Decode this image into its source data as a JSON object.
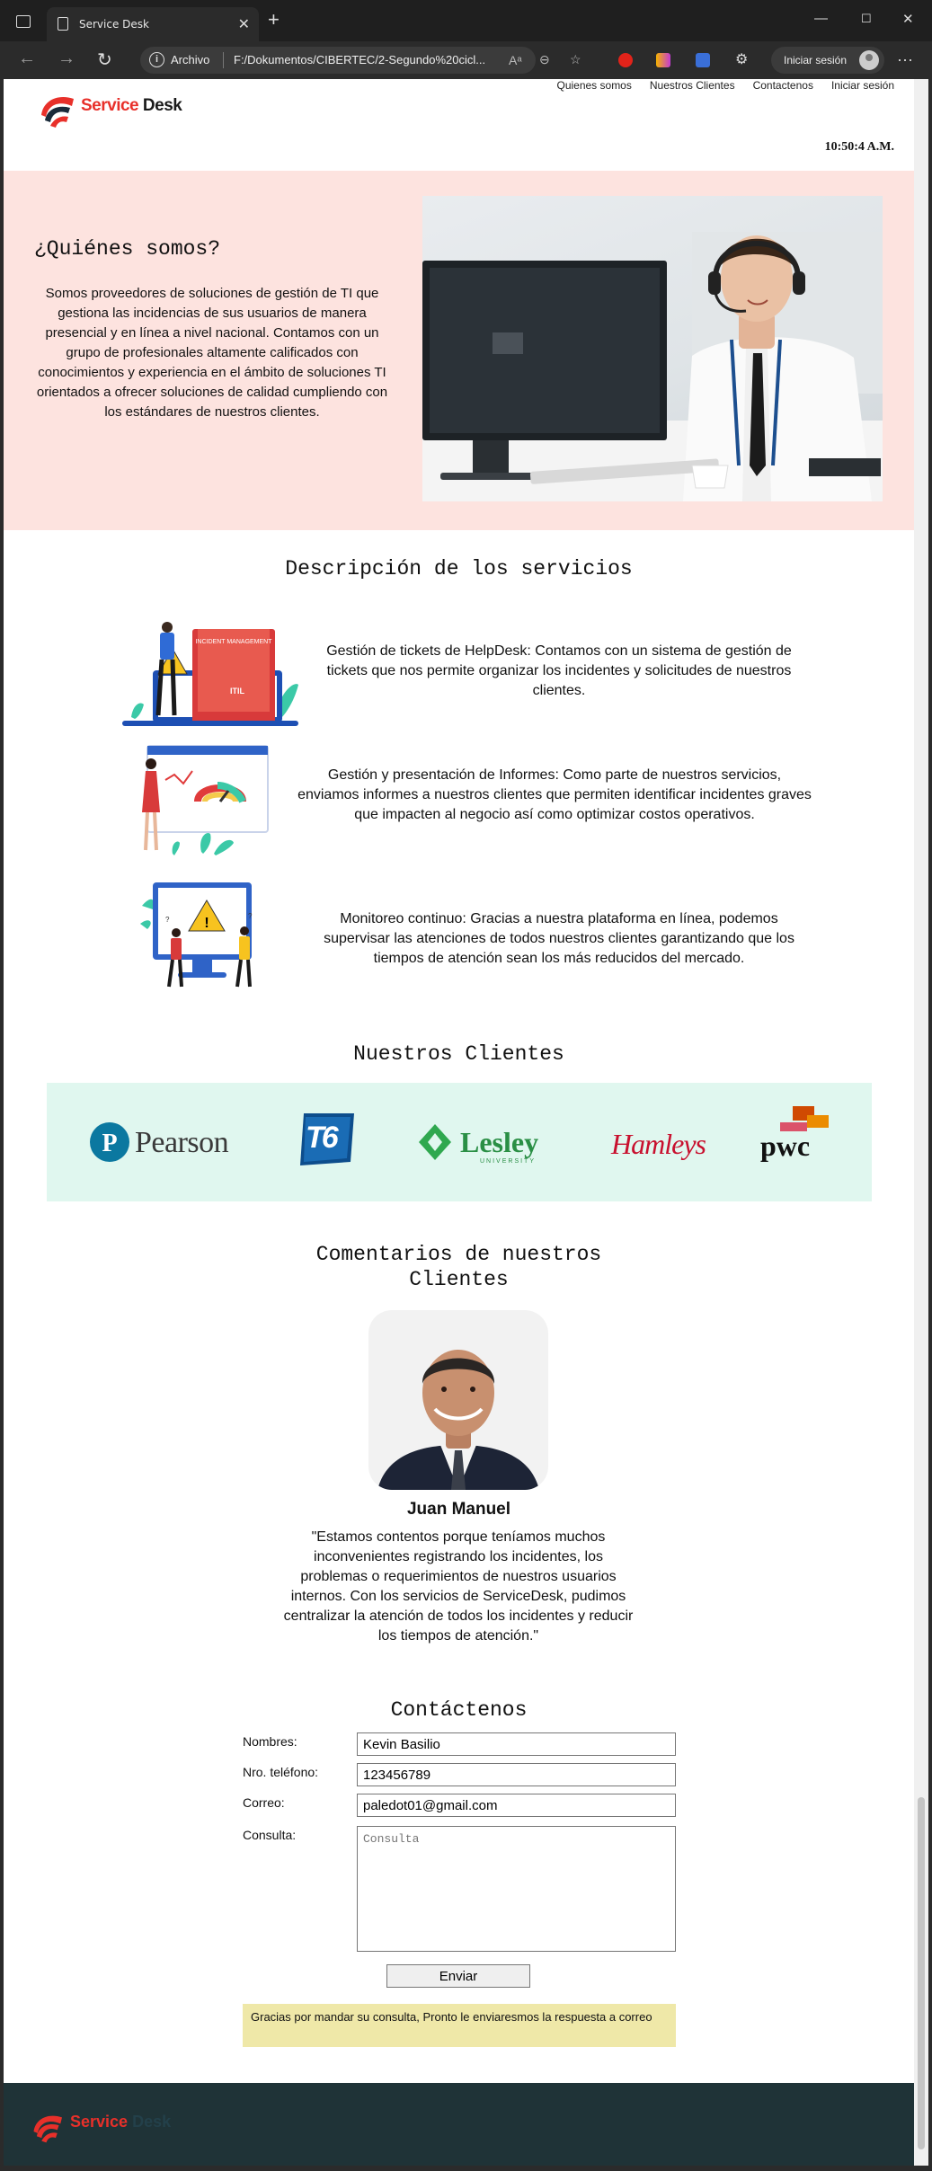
{
  "browser": {
    "tab_title": "Service Desk",
    "url_label": "Archivo",
    "url": "F:/Dokumentos/CIBERTEC/2-Segundo%20cicl...",
    "signin_label": "Iniciar sesión"
  },
  "header": {
    "logo_red": "Service",
    "logo_dark": " Desk",
    "nav": [
      "Quienes somos",
      "Nuestros Clientes",
      "Contactenos",
      "Iniciar sesión"
    ],
    "clock": "10:50:4 A.M."
  },
  "about": {
    "title": "¿Quiénes somos?",
    "text": "Somos proveedores de soluciones de gestión de TI que gestiona las incidencias de sus usuarios de manera presencial y en línea a nivel nacional. Contamos con un grupo de profesionales altamente calificados con conocimientos y experiencia en el ámbito de soluciones TI orientados a ofrecer soluciones de calidad cumpliendo con los estándares de nuestros clientes."
  },
  "services": {
    "title": "Descripción de los servicios",
    "items": [
      {
        "text": "Gestión de tickets de HelpDesk: Contamos con un sistema de gestión de tickets que nos permite organizar los incidentes y solicitudes de nuestros clientes.",
        "illus_label": "INCIDENT MANAGEMENT",
        "illus_sub": "ITIL"
      },
      {
        "text": "Gestión y presentación de Informes: Como parte de nuestros servicios, enviamos informes a nuestros clientes que permiten identificar incidentes graves que impacten al negocio así como optimizar costos operativos."
      },
      {
        "text": "Monitoreo continuo: Gracias a nuestra plataforma en línea, podemos supervisar las atenciones de todos nuestros clientes garantizando que los tiempos de atención sean los más reducidos del mercado."
      }
    ]
  },
  "clients": {
    "title": "Nuestros Clientes",
    "logos": [
      "Pearson",
      "T6",
      "Lesley",
      "UNIVERSITY",
      "Hamleys",
      "pwc"
    ]
  },
  "comments": {
    "title_line1": "Comentarios de nuestros",
    "title_line2": "Clientes",
    "name": "Juan Manuel",
    "text": "\"Estamos contentos porque teníamos muchos inconvenientes registrando los incidentes, los problemas o requerimientos de nuestros usuarios internos. Con los servicios de ServiceDesk, pudimos centralizar la atención de todos los incidentes y reducir los tiempos de atención.\""
  },
  "contact": {
    "title": "Contáctenos",
    "labels": {
      "name": "Nombres:",
      "phone": "Nro. teléfono:",
      "email": "Correo:",
      "query": "Consulta:"
    },
    "values": {
      "name": "Kevin Basilio",
      "phone": "123456789",
      "email": "paledot01@gmail.com"
    },
    "query_placeholder": "Consulta",
    "send": "Enviar",
    "thanks": "Gracias por mandar su consulta, Pronto le enviaresmos la respuesta a correo"
  },
  "footer": {
    "logo_red": "Service",
    "logo_dark": " Desk"
  },
  "colors": {
    "brand_red": "#e8302a",
    "about_bg": "#fde3df",
    "clients_bg": "#e0f7ef",
    "footer_bg": "#1f3337",
    "notice_bg": "#efe8a8"
  }
}
